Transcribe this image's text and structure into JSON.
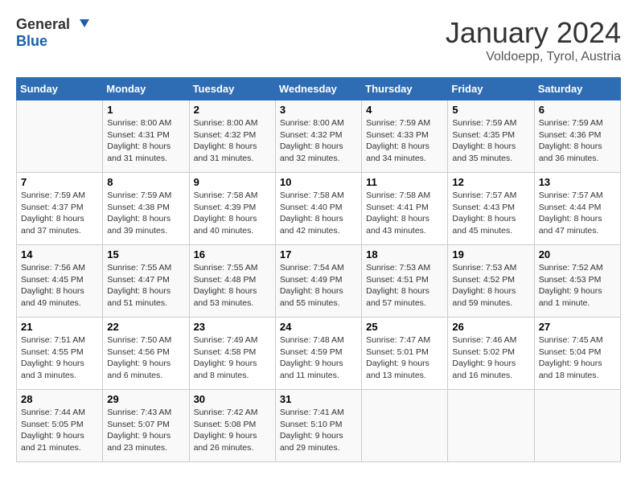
{
  "logo": {
    "general": "General",
    "blue": "Blue"
  },
  "header": {
    "month": "January 2024",
    "location": "Voldoepp, Tyrol, Austria"
  },
  "columns": [
    "Sunday",
    "Monday",
    "Tuesday",
    "Wednesday",
    "Thursday",
    "Friday",
    "Saturday"
  ],
  "weeks": [
    [
      {
        "day": "",
        "info": ""
      },
      {
        "day": "1",
        "info": "Sunrise: 8:00 AM\nSunset: 4:31 PM\nDaylight: 8 hours\nand 31 minutes."
      },
      {
        "day": "2",
        "info": "Sunrise: 8:00 AM\nSunset: 4:32 PM\nDaylight: 8 hours\nand 31 minutes."
      },
      {
        "day": "3",
        "info": "Sunrise: 8:00 AM\nSunset: 4:32 PM\nDaylight: 8 hours\nand 32 minutes."
      },
      {
        "day": "4",
        "info": "Sunrise: 7:59 AM\nSunset: 4:33 PM\nDaylight: 8 hours\nand 34 minutes."
      },
      {
        "day": "5",
        "info": "Sunrise: 7:59 AM\nSunset: 4:35 PM\nDaylight: 8 hours\nand 35 minutes."
      },
      {
        "day": "6",
        "info": "Sunrise: 7:59 AM\nSunset: 4:36 PM\nDaylight: 8 hours\nand 36 minutes."
      }
    ],
    [
      {
        "day": "7",
        "info": "Sunrise: 7:59 AM\nSunset: 4:37 PM\nDaylight: 8 hours\nand 37 minutes."
      },
      {
        "day": "8",
        "info": "Sunrise: 7:59 AM\nSunset: 4:38 PM\nDaylight: 8 hours\nand 39 minutes."
      },
      {
        "day": "9",
        "info": "Sunrise: 7:58 AM\nSunset: 4:39 PM\nDaylight: 8 hours\nand 40 minutes."
      },
      {
        "day": "10",
        "info": "Sunrise: 7:58 AM\nSunset: 4:40 PM\nDaylight: 8 hours\nand 42 minutes."
      },
      {
        "day": "11",
        "info": "Sunrise: 7:58 AM\nSunset: 4:41 PM\nDaylight: 8 hours\nand 43 minutes."
      },
      {
        "day": "12",
        "info": "Sunrise: 7:57 AM\nSunset: 4:43 PM\nDaylight: 8 hours\nand 45 minutes."
      },
      {
        "day": "13",
        "info": "Sunrise: 7:57 AM\nSunset: 4:44 PM\nDaylight: 8 hours\nand 47 minutes."
      }
    ],
    [
      {
        "day": "14",
        "info": "Sunrise: 7:56 AM\nSunset: 4:45 PM\nDaylight: 8 hours\nand 49 minutes."
      },
      {
        "day": "15",
        "info": "Sunrise: 7:55 AM\nSunset: 4:47 PM\nDaylight: 8 hours\nand 51 minutes."
      },
      {
        "day": "16",
        "info": "Sunrise: 7:55 AM\nSunset: 4:48 PM\nDaylight: 8 hours\nand 53 minutes."
      },
      {
        "day": "17",
        "info": "Sunrise: 7:54 AM\nSunset: 4:49 PM\nDaylight: 8 hours\nand 55 minutes."
      },
      {
        "day": "18",
        "info": "Sunrise: 7:53 AM\nSunset: 4:51 PM\nDaylight: 8 hours\nand 57 minutes."
      },
      {
        "day": "19",
        "info": "Sunrise: 7:53 AM\nSunset: 4:52 PM\nDaylight: 8 hours\nand 59 minutes."
      },
      {
        "day": "20",
        "info": "Sunrise: 7:52 AM\nSunset: 4:53 PM\nDaylight: 9 hours\nand 1 minute."
      }
    ],
    [
      {
        "day": "21",
        "info": "Sunrise: 7:51 AM\nSunset: 4:55 PM\nDaylight: 9 hours\nand 3 minutes."
      },
      {
        "day": "22",
        "info": "Sunrise: 7:50 AM\nSunset: 4:56 PM\nDaylight: 9 hours\nand 6 minutes."
      },
      {
        "day": "23",
        "info": "Sunrise: 7:49 AM\nSunset: 4:58 PM\nDaylight: 9 hours\nand 8 minutes."
      },
      {
        "day": "24",
        "info": "Sunrise: 7:48 AM\nSunset: 4:59 PM\nDaylight: 9 hours\nand 11 minutes."
      },
      {
        "day": "25",
        "info": "Sunrise: 7:47 AM\nSunset: 5:01 PM\nDaylight: 9 hours\nand 13 minutes."
      },
      {
        "day": "26",
        "info": "Sunrise: 7:46 AM\nSunset: 5:02 PM\nDaylight: 9 hours\nand 16 minutes."
      },
      {
        "day": "27",
        "info": "Sunrise: 7:45 AM\nSunset: 5:04 PM\nDaylight: 9 hours\nand 18 minutes."
      }
    ],
    [
      {
        "day": "28",
        "info": "Sunrise: 7:44 AM\nSunset: 5:05 PM\nDaylight: 9 hours\nand 21 minutes."
      },
      {
        "day": "29",
        "info": "Sunrise: 7:43 AM\nSunset: 5:07 PM\nDaylight: 9 hours\nand 23 minutes."
      },
      {
        "day": "30",
        "info": "Sunrise: 7:42 AM\nSunset: 5:08 PM\nDaylight: 9 hours\nand 26 minutes."
      },
      {
        "day": "31",
        "info": "Sunrise: 7:41 AM\nSunset: 5:10 PM\nDaylight: 9 hours\nand 29 minutes."
      },
      {
        "day": "",
        "info": ""
      },
      {
        "day": "",
        "info": ""
      },
      {
        "day": "",
        "info": ""
      }
    ]
  ]
}
